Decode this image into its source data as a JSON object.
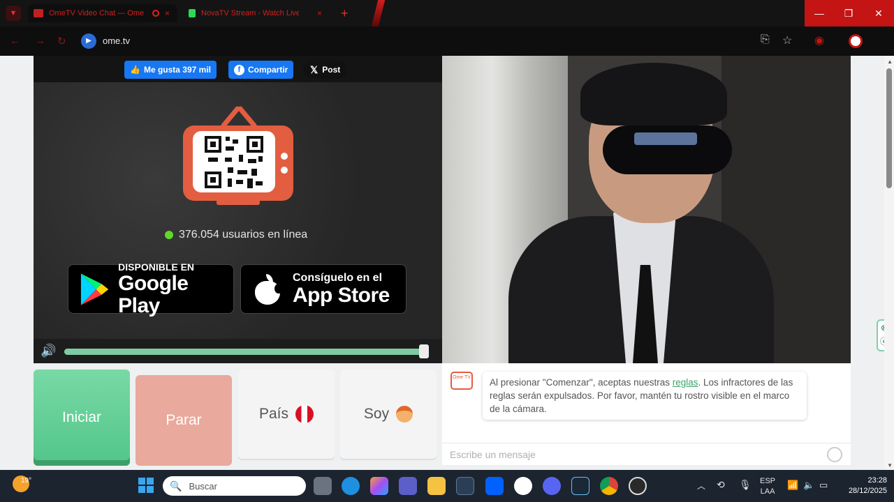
{
  "browser": {
    "tabs": [
      {
        "title": "OmeTV Video Chat — Ome",
        "close": "×",
        "active": true
      },
      {
        "title": "NovaTV Stream - Watch Live",
        "close": "×",
        "active": false
      }
    ],
    "new_tab": "+",
    "url": "ome.tv"
  },
  "social": {
    "like_label": "Me gusta 397 mil",
    "share_label": "Compartir",
    "post_label": "Post"
  },
  "stats": {
    "online_text": "376.054 usuarios en línea"
  },
  "stores": {
    "google_small": "DISPONIBLE EN",
    "google_big": "Google Play",
    "apple_small": "Consíguelo en el",
    "apple_big": "App Store"
  },
  "volume": {
    "level": 0.99
  },
  "controls": {
    "start_label": "Iniciar",
    "stop_label": "Parar",
    "country_label": "País",
    "gender_label": "Soy"
  },
  "chat": {
    "logo_text": "Ome TV",
    "msg_before": "Al presionar \"Comenzar\", aceptas nuestras ",
    "msg_link": "reglas",
    "msg_after": ". Los infractores de las reglas serán expulsados. Por favor, mantén tu rostro visible en el marco de la cámara.",
    "input_placeholder": "Escribe un mensaje"
  },
  "taskbar": {
    "temperature": "19°",
    "search_placeholder": "Buscar",
    "lang_top": "ESP",
    "lang_bottom": "LAA",
    "time": "23:28",
    "date": "28/12/2025"
  },
  "colors": {
    "accent_green": "#5fd88f",
    "stop_pink": "#e9a99d",
    "brand_orange": "#e35d40",
    "facebook_blue": "#1877f2"
  }
}
